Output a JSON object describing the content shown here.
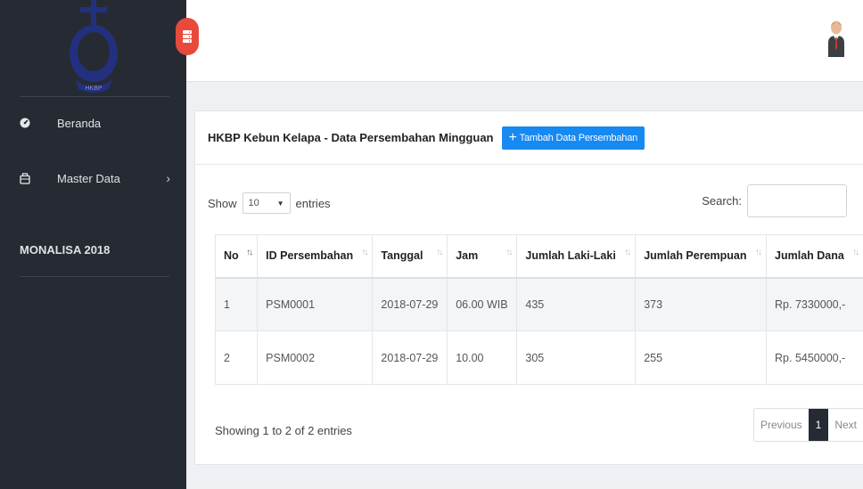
{
  "sidebar": {
    "items": [
      {
        "label": "Beranda",
        "icon": "dashboard-icon"
      },
      {
        "label": "Master Data",
        "icon": "briefcase-icon",
        "chevron": "›"
      }
    ],
    "heading": "MONALISA 2018",
    "logo_text": "HKBP"
  },
  "colors": {
    "sidebar_bg": "#262b33",
    "accent_red": "#e74a3b",
    "primary_blue": "#1789f2",
    "logo_blue": "#23307f"
  },
  "card": {
    "title": "HKBP Kebun Kelapa - Data Persembahan Mingguan",
    "add_button": "Tambah Data Persembahan",
    "add_icon": "+"
  },
  "controls": {
    "show_label": "Show",
    "entries_value": "10",
    "entries_label": "entries",
    "search_label": "Search:"
  },
  "table": {
    "columns": [
      "No",
      "ID Persembahan",
      "Tanggal",
      "Jam",
      "Jumlah Laki-Laki",
      "Jumlah Perempuan",
      "Jumlah Dana"
    ],
    "rows": [
      [
        "1",
        "PSM0001",
        "2018-07-29",
        "06.00 WIB",
        "435",
        "373",
        "Rp. 7330000,-"
      ],
      [
        "2",
        "PSM0002",
        "2018-07-29",
        "10.00",
        "305",
        "255",
        "Rp. 5450000,-"
      ]
    ]
  },
  "footer": {
    "info": "Showing 1 to 2 of 2 entries",
    "previous": "Previous",
    "current_page": "1",
    "next": "Next"
  }
}
